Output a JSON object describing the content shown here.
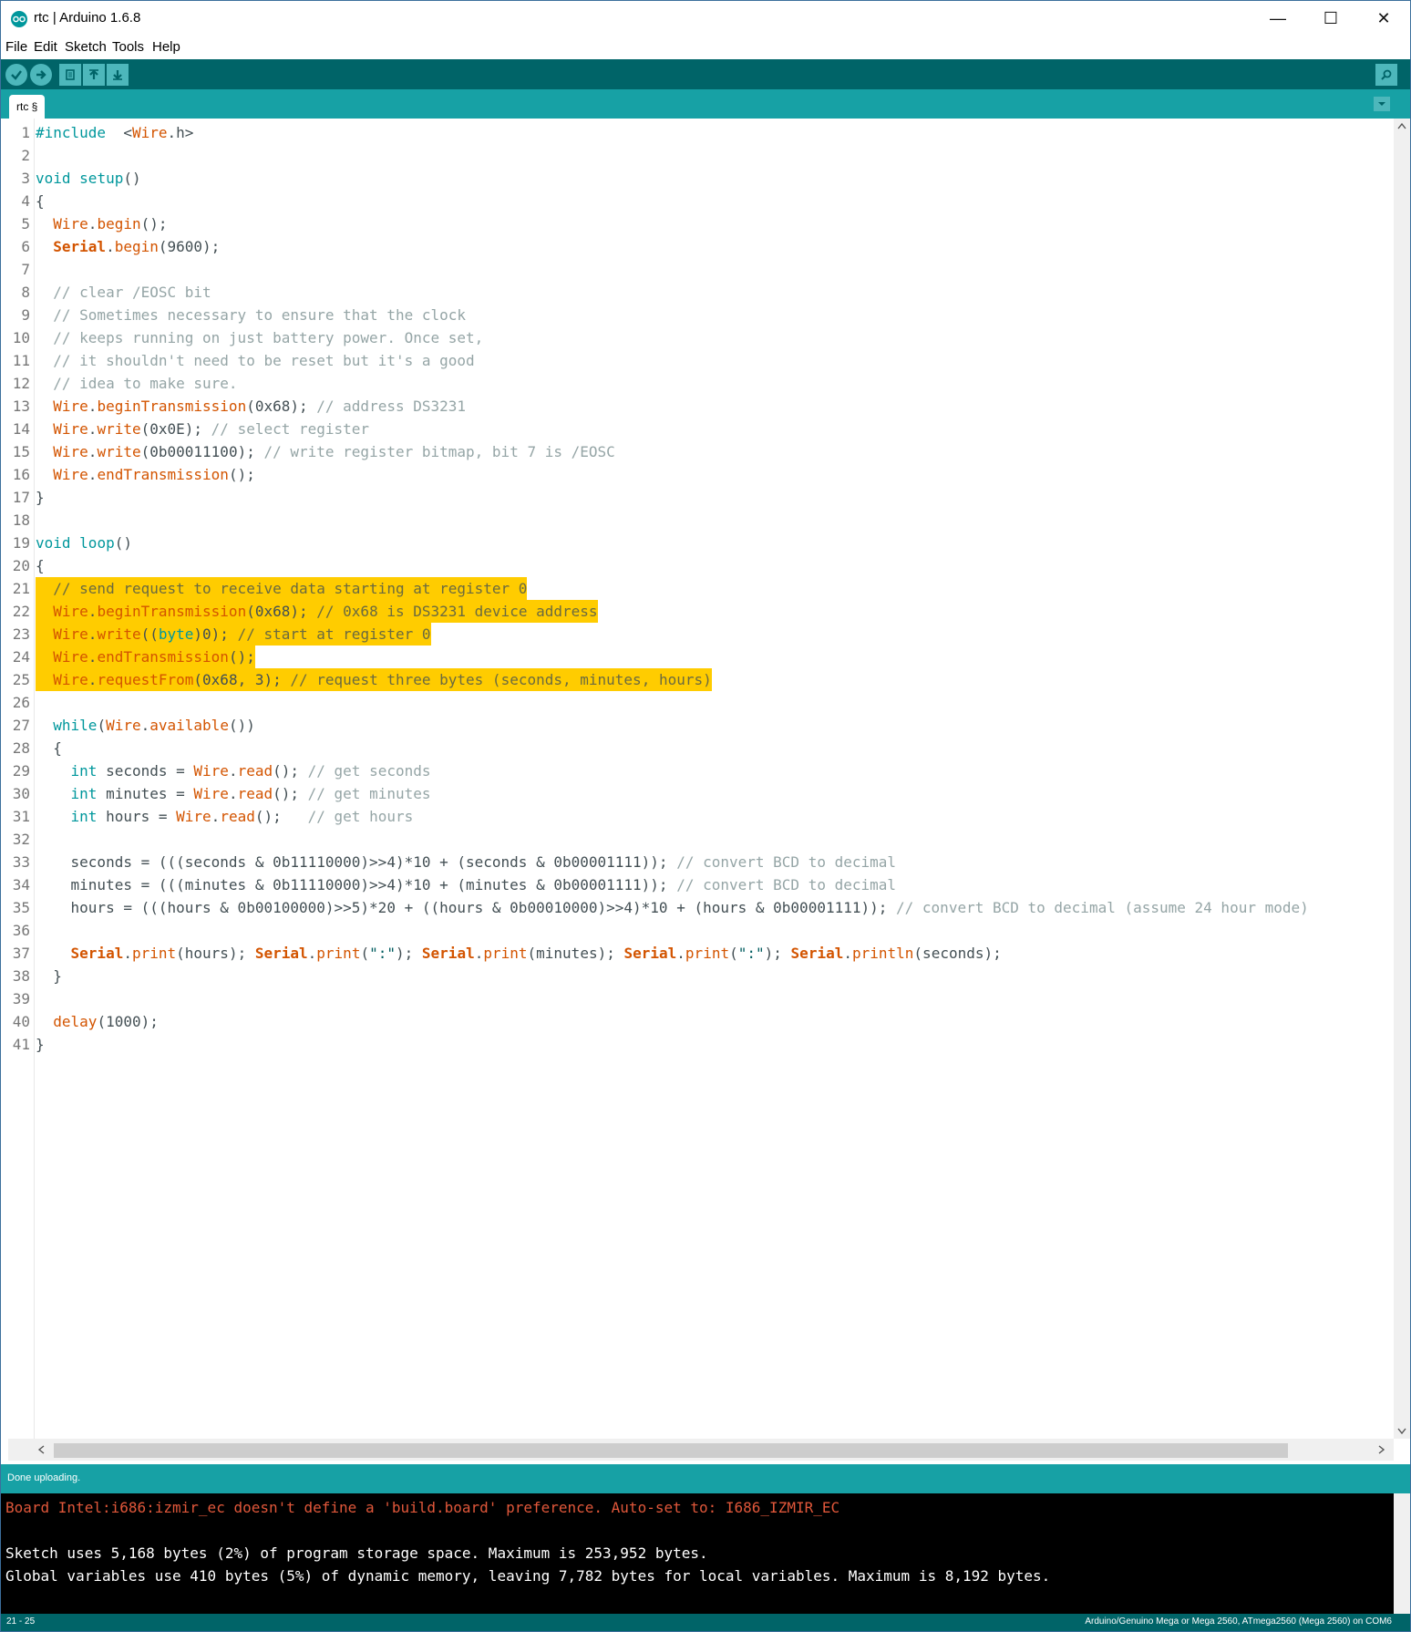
{
  "window": {
    "title": "rtc | Arduino 1.6.8",
    "minimize": "—",
    "maximize": "☐",
    "close": "✕"
  },
  "menu": {
    "file": "File",
    "edit": "Edit",
    "sketch": "Sketch",
    "tools": "Tools",
    "help": "Help"
  },
  "toolbar": {
    "verify_icon": "check-icon",
    "upload_icon": "arrow-right-icon",
    "new_icon": "document-icon",
    "open_icon": "arrow-up-icon",
    "save_icon": "arrow-down-icon",
    "serial_monitor_icon": "magnifier-icon"
  },
  "tabs": [
    {
      "label": "rtc §"
    }
  ],
  "editor": {
    "lines": [
      {
        "n": "1",
        "segs": [
          [
            "kw",
            "#include"
          ],
          [
            "",
            "  "
          ],
          [
            "",
            "<"
          ],
          [
            "fn",
            "Wire"
          ],
          [
            "",
            ".h>"
          ]
        ]
      },
      {
        "n": "2",
        "segs": []
      },
      {
        "n": "3",
        "segs": [
          [
            "kw",
            "void"
          ],
          [
            "",
            " "
          ],
          [
            "kw",
            "setup"
          ],
          [
            "",
            "()"
          ]
        ]
      },
      {
        "n": "4",
        "segs": [
          [
            "",
            "{"
          ]
        ]
      },
      {
        "n": "5",
        "segs": [
          [
            "",
            "  "
          ],
          [
            "fn",
            "Wire"
          ],
          [
            "",
            "."
          ],
          [
            "fn",
            "begin"
          ],
          [
            "",
            "();"
          ]
        ]
      },
      {
        "n": "6",
        "segs": [
          [
            "",
            "  "
          ],
          [
            "obj",
            "Serial"
          ],
          [
            "",
            "."
          ],
          [
            "fn",
            "begin"
          ],
          [
            "",
            "(9600);"
          ]
        ]
      },
      {
        "n": "7",
        "segs": []
      },
      {
        "n": "8",
        "segs": [
          [
            "",
            "  "
          ],
          [
            "cm",
            "// clear /EOSC bit"
          ]
        ]
      },
      {
        "n": "9",
        "segs": [
          [
            "",
            "  "
          ],
          [
            "cm",
            "// Sometimes necessary to ensure that the clock"
          ]
        ]
      },
      {
        "n": "10",
        "segs": [
          [
            "",
            "  "
          ],
          [
            "cm",
            "// keeps running on just battery power. Once set,"
          ]
        ]
      },
      {
        "n": "11",
        "segs": [
          [
            "",
            "  "
          ],
          [
            "cm",
            "// it shouldn't need to be reset but it's a good"
          ]
        ]
      },
      {
        "n": "12",
        "segs": [
          [
            "",
            "  "
          ],
          [
            "cm",
            "// idea to make sure."
          ]
        ]
      },
      {
        "n": "13",
        "segs": [
          [
            "",
            "  "
          ],
          [
            "fn",
            "Wire"
          ],
          [
            "",
            "."
          ],
          [
            "fn",
            "beginTransmission"
          ],
          [
            "",
            "(0x68); "
          ],
          [
            "cm",
            "// address DS3231"
          ]
        ]
      },
      {
        "n": "14",
        "segs": [
          [
            "",
            "  "
          ],
          [
            "fn",
            "Wire"
          ],
          [
            "",
            "."
          ],
          [
            "fn",
            "write"
          ],
          [
            "",
            "(0x0E); "
          ],
          [
            "cm",
            "// select register"
          ]
        ]
      },
      {
        "n": "15",
        "segs": [
          [
            "",
            "  "
          ],
          [
            "fn",
            "Wire"
          ],
          [
            "",
            "."
          ],
          [
            "fn",
            "write"
          ],
          [
            "",
            "(0b00011100); "
          ],
          [
            "cm",
            "// write register bitmap, bit 7 is /EOSC"
          ]
        ]
      },
      {
        "n": "16",
        "segs": [
          [
            "",
            "  "
          ],
          [
            "fn",
            "Wire"
          ],
          [
            "",
            "."
          ],
          [
            "fn",
            "endTransmission"
          ],
          [
            "",
            "();"
          ]
        ]
      },
      {
        "n": "17",
        "segs": [
          [
            "",
            "}"
          ]
        ]
      },
      {
        "n": "18",
        "segs": []
      },
      {
        "n": "19",
        "segs": [
          [
            "kw",
            "void"
          ],
          [
            "",
            " "
          ],
          [
            "kw",
            "loop"
          ],
          [
            "",
            "()"
          ]
        ]
      },
      {
        "n": "20",
        "segs": [
          [
            "",
            "{"
          ]
        ]
      },
      {
        "n": "21",
        "hl": true,
        "segs": [
          [
            "",
            "  "
          ],
          [
            "cmh",
            "// send request to receive data starting at register 0"
          ]
        ]
      },
      {
        "n": "22",
        "hl": true,
        "segs": [
          [
            "",
            "  "
          ],
          [
            "fn",
            "Wire"
          ],
          [
            "",
            "."
          ],
          [
            "fn",
            "beginTransmission"
          ],
          [
            "",
            "(0x68); "
          ],
          [
            "cmh",
            "// 0x68 is DS3231 device address"
          ]
        ]
      },
      {
        "n": "23",
        "hl": true,
        "segs": [
          [
            "",
            "  "
          ],
          [
            "fn",
            "Wire"
          ],
          [
            "",
            "."
          ],
          [
            "fn",
            "write"
          ],
          [
            "",
            "(("
          ],
          [
            "kw",
            "byte"
          ],
          [
            "",
            ")0); "
          ],
          [
            "cmh",
            "// start at register 0"
          ]
        ]
      },
      {
        "n": "24",
        "hl": true,
        "segs": [
          [
            "",
            "  "
          ],
          [
            "fn",
            "Wire"
          ],
          [
            "",
            "."
          ],
          [
            "fn",
            "endTransmission"
          ],
          [
            "",
            "();"
          ]
        ]
      },
      {
        "n": "25",
        "hl": true,
        "segs": [
          [
            "",
            "  "
          ],
          [
            "fn",
            "Wire"
          ],
          [
            "",
            "."
          ],
          [
            "fn",
            "requestFrom"
          ],
          [
            "",
            "(0x68, 3); "
          ],
          [
            "cmh",
            "// request three bytes (seconds, minutes, hours)"
          ]
        ]
      },
      {
        "n": "26",
        "segs": []
      },
      {
        "n": "27",
        "segs": [
          [
            "",
            "  "
          ],
          [
            "kw",
            "while"
          ],
          [
            "",
            "("
          ],
          [
            "fn",
            "Wire"
          ],
          [
            "",
            "."
          ],
          [
            "fn",
            "available"
          ],
          [
            "",
            "())"
          ]
        ]
      },
      {
        "n": "28",
        "segs": [
          [
            "",
            "  {"
          ]
        ]
      },
      {
        "n": "29",
        "segs": [
          [
            "",
            "    "
          ],
          [
            "kw",
            "int"
          ],
          [
            "",
            " seconds = "
          ],
          [
            "fn",
            "Wire"
          ],
          [
            "",
            "."
          ],
          [
            "fn",
            "read"
          ],
          [
            "",
            "(); "
          ],
          [
            "cm",
            "// get seconds"
          ]
        ]
      },
      {
        "n": "30",
        "segs": [
          [
            "",
            "    "
          ],
          [
            "kw",
            "int"
          ],
          [
            "",
            " minutes = "
          ],
          [
            "fn",
            "Wire"
          ],
          [
            "",
            "."
          ],
          [
            "fn",
            "read"
          ],
          [
            "",
            "(); "
          ],
          [
            "cm",
            "// get minutes"
          ]
        ]
      },
      {
        "n": "31",
        "segs": [
          [
            "",
            "    "
          ],
          [
            "kw",
            "int"
          ],
          [
            "",
            " hours = "
          ],
          [
            "fn",
            "Wire"
          ],
          [
            "",
            "."
          ],
          [
            "fn",
            "read"
          ],
          [
            "",
            "();   "
          ],
          [
            "cm",
            "// get hours"
          ]
        ]
      },
      {
        "n": "32",
        "segs": []
      },
      {
        "n": "33",
        "segs": [
          [
            "",
            "    seconds = (((seconds & 0b11110000)>>4)*10 + (seconds & 0b00001111)); "
          ],
          [
            "cm",
            "// convert BCD to decimal"
          ]
        ]
      },
      {
        "n": "34",
        "segs": [
          [
            "",
            "    minutes = (((minutes & 0b11110000)>>4)*10 + (minutes & 0b00001111)); "
          ],
          [
            "cm",
            "// convert BCD to decimal"
          ]
        ]
      },
      {
        "n": "35",
        "segs": [
          [
            "",
            "    hours = (((hours & 0b00100000)>>5)*20 + ((hours & 0b00010000)>>4)*10 + (hours & 0b00001111)); "
          ],
          [
            "cm",
            "// convert BCD to decimal (assume 24 hour mode)"
          ]
        ]
      },
      {
        "n": "36",
        "segs": []
      },
      {
        "n": "37",
        "segs": [
          [
            "",
            "    "
          ],
          [
            "obj",
            "Serial"
          ],
          [
            "",
            "."
          ],
          [
            "fn",
            "print"
          ],
          [
            "",
            "(hours); "
          ],
          [
            "obj",
            "Serial"
          ],
          [
            "",
            "."
          ],
          [
            "fn",
            "print"
          ],
          [
            "",
            "("
          ],
          [
            "str",
            "\":\""
          ],
          [
            "",
            "); "
          ],
          [
            "obj",
            "Serial"
          ],
          [
            "",
            "."
          ],
          [
            "fn",
            "print"
          ],
          [
            "",
            "(minutes); "
          ],
          [
            "obj",
            "Serial"
          ],
          [
            "",
            "."
          ],
          [
            "fn",
            "print"
          ],
          [
            "",
            "("
          ],
          [
            "str",
            "\":\""
          ],
          [
            "",
            "); "
          ],
          [
            "obj",
            "Serial"
          ],
          [
            "",
            "."
          ],
          [
            "fn",
            "println"
          ],
          [
            "",
            "(seconds);"
          ]
        ]
      },
      {
        "n": "38",
        "segs": [
          [
            "",
            "  }"
          ]
        ]
      },
      {
        "n": "39",
        "segs": []
      },
      {
        "n": "40",
        "segs": [
          [
            "",
            "  "
          ],
          [
            "fn",
            "delay"
          ],
          [
            "",
            "(1000);"
          ]
        ]
      },
      {
        "n": "41",
        "segs": [
          [
            "",
            "}"
          ]
        ]
      }
    ]
  },
  "status": {
    "message": "Done uploading."
  },
  "console": {
    "lines": [
      {
        "text": "Board Intel:i686:izmir_ec doesn't define a 'build.board' preference. Auto-set to: I686_IZMIR_EC",
        "color": "#e0573a"
      },
      {
        "text": "",
        "color": "#ffffff"
      },
      {
        "text": "Sketch uses 5,168 bytes (2%) of program storage space. Maximum is 253,952 bytes.",
        "color": "#ffffff"
      },
      {
        "text": "Global variables use 410 bytes (5%) of dynamic memory, leaving 7,782 bytes for local variables. Maximum is 8,192 bytes.",
        "color": "#ffffff"
      }
    ]
  },
  "footer": {
    "line_range": "21 - 25",
    "board": "Arduino/Genuino Mega or Mega 2560, ATmega2560 (Mega 2560) on COM6"
  },
  "colors": {
    "toolbar": "#006468",
    "tabbar": "#17a1a5",
    "highlight": "#ffcc00",
    "keyword": "#00979c",
    "function": "#d35400",
    "comment": "#95a5a6"
  }
}
